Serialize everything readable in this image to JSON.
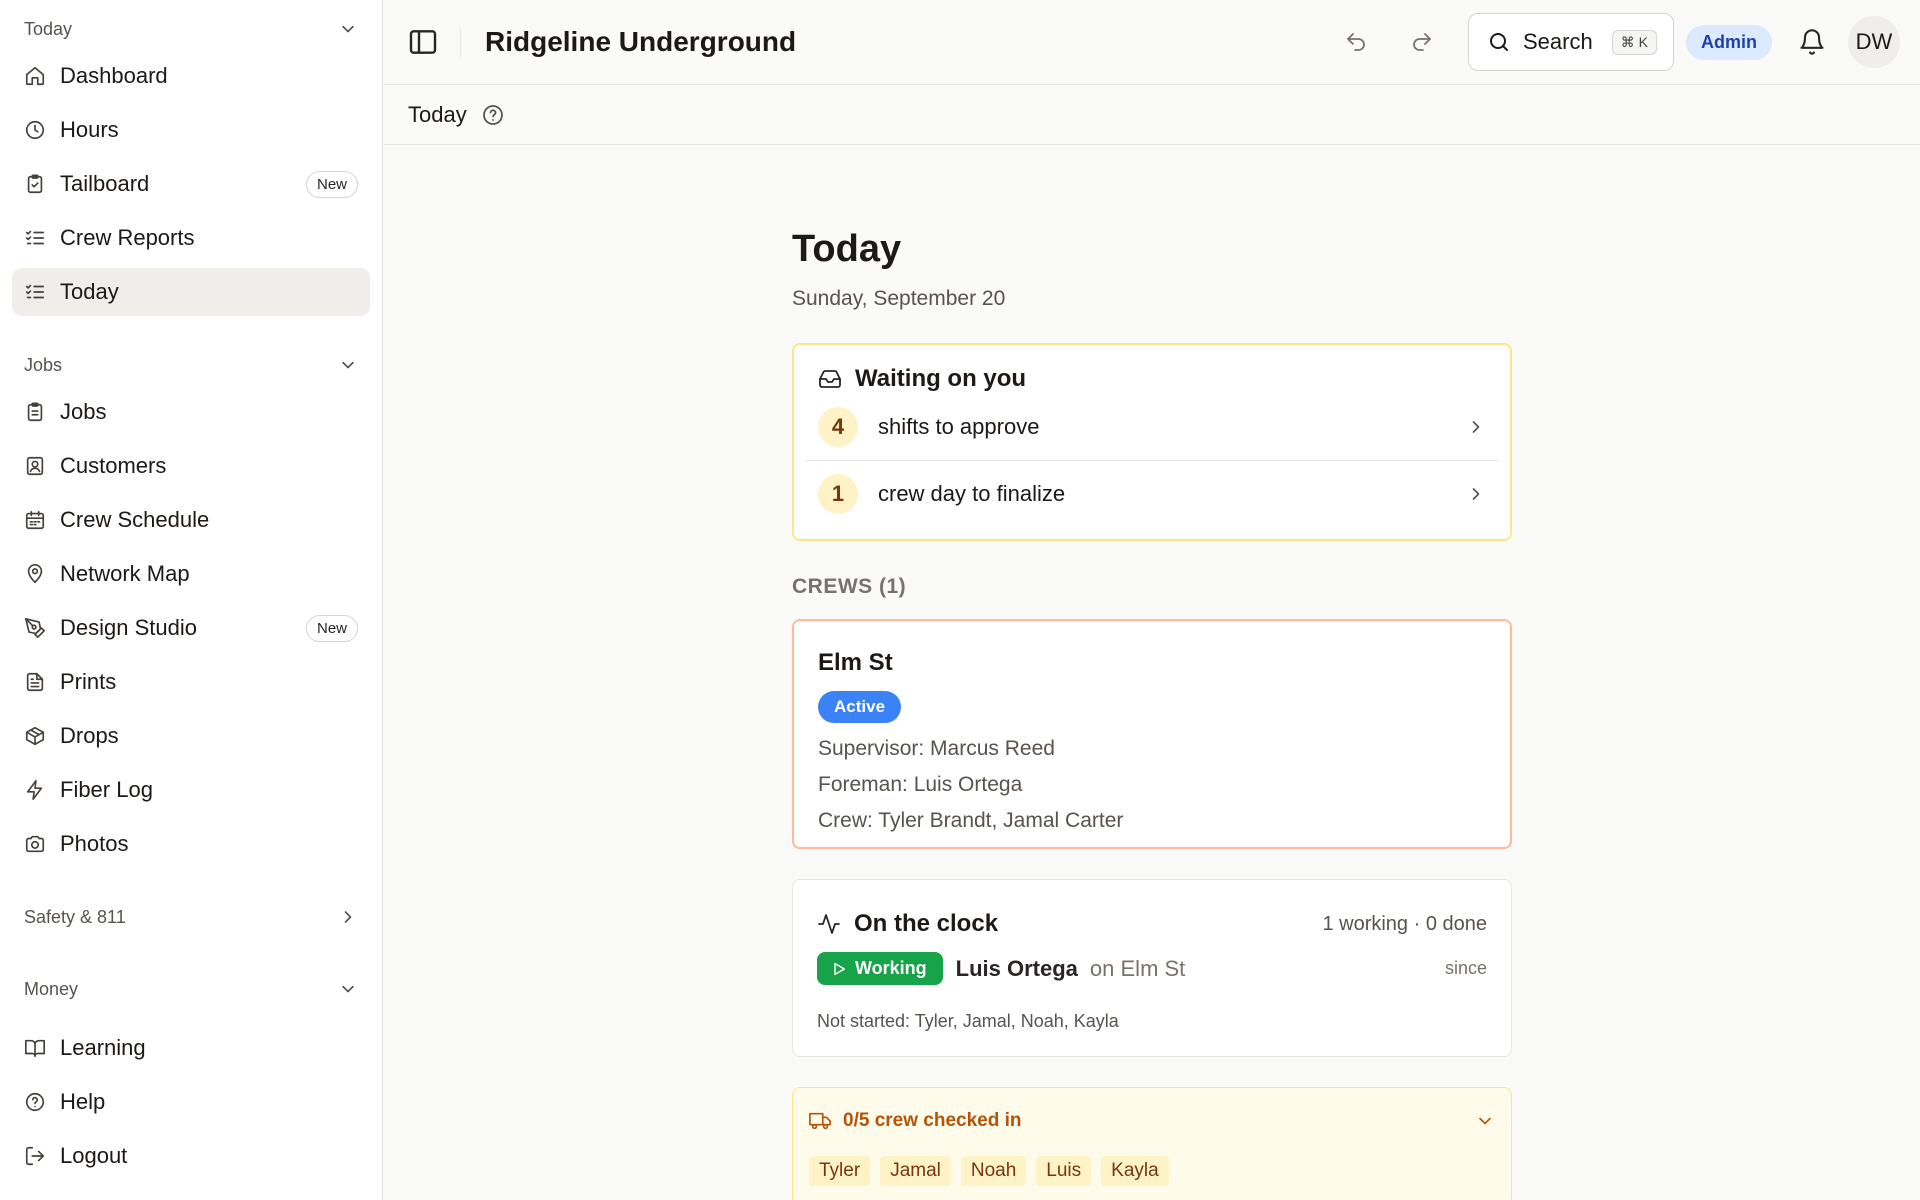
{
  "sidebar": {
    "sections": {
      "today": "Today",
      "jobs": "Jobs",
      "safety": "Safety & 811",
      "money": "Money"
    },
    "today_items": [
      {
        "label": "Dashboard",
        "icon": "home-icon"
      },
      {
        "label": "Hours",
        "icon": "clock-icon"
      },
      {
        "label": "Tailboard",
        "icon": "clipboard-icon",
        "badge": "New"
      },
      {
        "label": "Crew Reports",
        "icon": "checklist-icon"
      },
      {
        "label": "Today",
        "icon": "checklist-icon",
        "active": true
      }
    ],
    "jobs_items": [
      {
        "label": "Jobs",
        "icon": "clipboard-list-icon"
      },
      {
        "label": "Customers",
        "icon": "contact-icon"
      },
      {
        "label": "Crew Schedule",
        "icon": "calendar-icon"
      },
      {
        "label": "Network Map",
        "icon": "map-pin-icon"
      },
      {
        "label": "Design Studio",
        "icon": "pen-tool-icon",
        "badge": "New"
      },
      {
        "label": "Prints",
        "icon": "file-text-icon"
      },
      {
        "label": "Drops",
        "icon": "package-icon"
      },
      {
        "label": "Fiber Log",
        "icon": "zap-icon"
      },
      {
        "label": "Photos",
        "icon": "camera-icon"
      }
    ],
    "bottom_items": [
      {
        "label": "Learning",
        "icon": "book-icon"
      },
      {
        "label": "Help",
        "icon": "help-circle-icon"
      },
      {
        "label": "Logout",
        "icon": "logout-icon"
      }
    ]
  },
  "topbar": {
    "org_name": "Ridgeline Underground",
    "search_label": "Search",
    "search_shortcut": "⌘ K",
    "role_badge": "Admin",
    "avatar_initials": "DW"
  },
  "subbar": {
    "crumb": "Today"
  },
  "main": {
    "title": "Today",
    "date": "Sunday, September 20",
    "waiting": {
      "title": "Waiting on you",
      "rows": [
        {
          "count": "4",
          "text": "shifts to approve"
        },
        {
          "count": "1",
          "text": "crew day to finalize"
        }
      ]
    },
    "crews_label": "CREWS (1)",
    "crew": {
      "name": "Elm St",
      "status": "Active",
      "supervisor": "Supervisor: Marcus Reed",
      "foreman": "Foreman: Luis Ortega",
      "members": "Crew: Tyler Brandt, Jamal Carter"
    },
    "clock": {
      "title": "On the clock",
      "summary": "1 working · 0 done",
      "status": "Working",
      "worker": "Luis Ortega",
      "location": "on Elm St",
      "since": "since",
      "not_started": "Not started: Tyler, Jamal, Noah, Kayla"
    },
    "checkin": {
      "label": "0/5 crew checked in",
      "chips": [
        "Tyler",
        "Jamal",
        "Noah",
        "Luis",
        "Kayla"
      ]
    }
  },
  "colors": {
    "accent_blue": "#3b82f6",
    "working_green": "#16a34a",
    "amber_border": "#fde68a",
    "crew_border": "#fdba9a"
  }
}
